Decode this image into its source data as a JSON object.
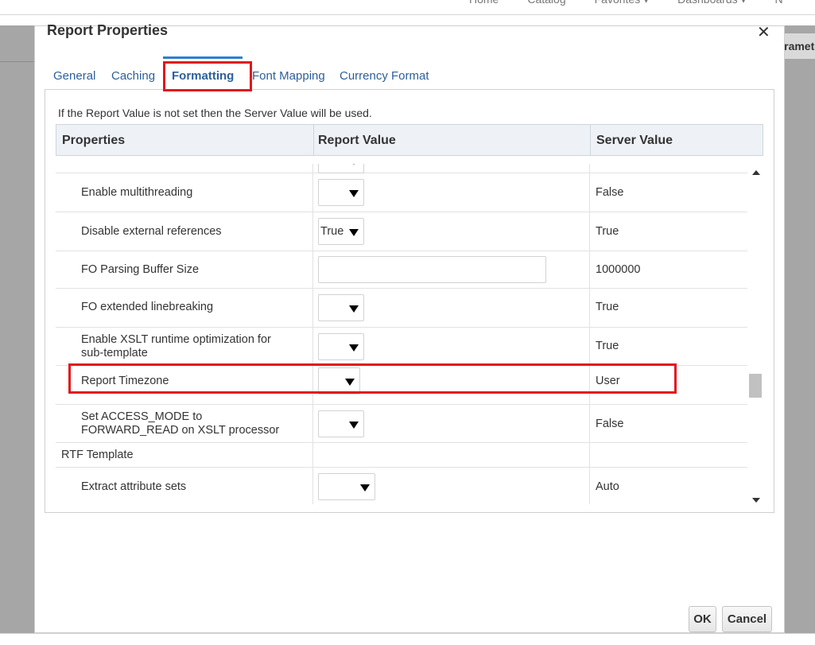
{
  "app": {
    "nav": [
      "Home",
      "Catalog",
      "Favorites ▾",
      "Dashboards ▾",
      "N"
    ],
    "right_tab_label": "Parameters"
  },
  "dialog": {
    "title": "Report Properties",
    "close_glyph": "✕",
    "tabs": [
      {
        "label": "General",
        "active": false
      },
      {
        "label": "Caching",
        "active": false
      },
      {
        "label": "Formatting",
        "active": true
      },
      {
        "label": "Font Mapping",
        "active": false
      },
      {
        "label": "Currency Format",
        "active": false
      }
    ],
    "info_text": "If the Report Value is not set then the Server Value will be used.",
    "columns": [
      "Properties",
      "Report Value",
      "Server Value"
    ],
    "rows": [
      {
        "property": "",
        "report_value": "",
        "control": "select",
        "server_value": ""
      },
      {
        "property": "Enable multithreading",
        "report_value": "",
        "control": "select",
        "server_value": "False"
      },
      {
        "property": "Disable external references",
        "report_value": "True",
        "control": "select",
        "server_value": "True"
      },
      {
        "property": "FO Parsing Buffer Size",
        "report_value": "",
        "control": "text",
        "server_value": "1000000"
      },
      {
        "property": "FO extended linebreaking",
        "report_value": "",
        "control": "select",
        "server_value": "True"
      },
      {
        "property": "Enable XSLT runtime optimization for sub-template",
        "report_value": "",
        "control": "select",
        "server_value": "True"
      },
      {
        "property": "Report Timezone",
        "report_value": "",
        "control": "select",
        "server_value": "User"
      },
      {
        "property": "Set ACCESS_MODE to FORWARD_READ on XSLT processor",
        "report_value": "",
        "control": "select",
        "server_value": "False"
      },
      {
        "property": "RTF Template",
        "report_value": "",
        "control": "group",
        "server_value": ""
      },
      {
        "property": "Extract attribute sets",
        "report_value": "",
        "control": "select",
        "server_value": "Auto"
      }
    ],
    "buttons": {
      "ok": "OK",
      "cancel": "Cancel"
    }
  },
  "colors": {
    "link": "#2c5f9b",
    "highlight": "#e0161b",
    "overlay": "#a6a6a6"
  }
}
